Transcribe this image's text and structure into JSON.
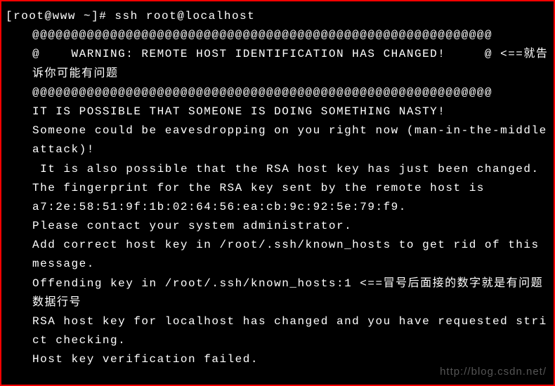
{
  "terminal": {
    "prompt_line": "[root@www ~]# ssh root@localhost",
    "at_bar1": "@@@@@@@@@@@@@@@@@@@@@@@@@@@@@@@@@@@@@@@@@@@@@@@@@@@@@@@@@@@",
    "warning_line": "@    WARNING: REMOTE HOST IDENTIFICATION HAS CHANGED!     @ <==就告诉你可能有问题",
    "at_bar2": "@@@@@@@@@@@@@@@@@@@@@@@@@@@@@@@@@@@@@@@@@@@@@@@@@@@@@@@@@@@",
    "nasty": "IT IS POSSIBLE THAT SOMEONE IS DOING SOMETHING NASTY!",
    "eavesdrop": "Someone could be eavesdropping on you right now (man-in-the-middle attack)!",
    "rsa_changed": " It is also possible that the RSA host key has just been changed.",
    "fingerprint_intro": "The fingerprint for the RSA key sent by the remote host is",
    "fingerprint": "a7:2e:58:51:9f:1b:02:64:56:ea:cb:9c:92:5e:79:f9.",
    "contact": "Please contact your system administrator.",
    "add_key": "Add correct host key in /root/.ssh/known_hosts to get rid of this message.",
    "offending": "Offending key in /root/.ssh/known_hosts:1 <==冒号后面接的数字就是有问题数据行号",
    "strict": "RSA host key for localhost has changed and you have requested strict checking.",
    "failed": "Host key verification failed."
  },
  "watermark": "http://blog.csdn.net/"
}
